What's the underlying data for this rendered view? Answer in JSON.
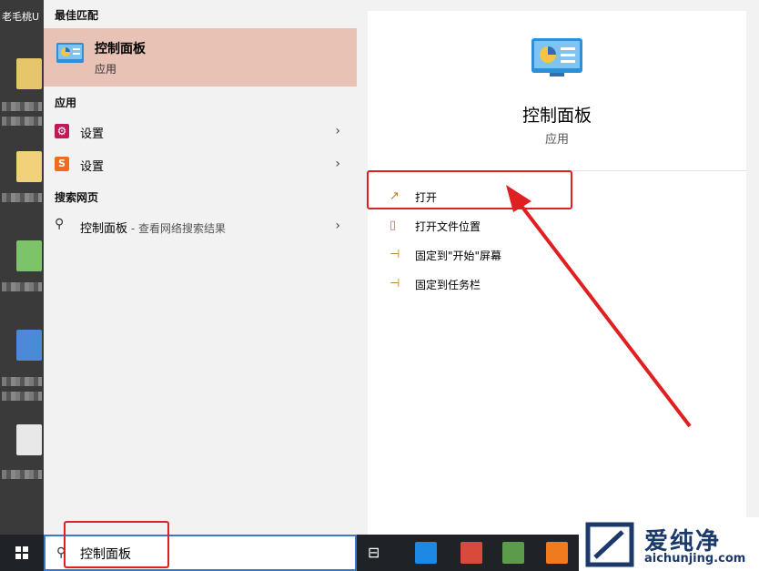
{
  "desktop": {
    "label": "老毛桃U"
  },
  "left": {
    "best_match_label": "最佳匹配",
    "best_match": {
      "title": "控制面板",
      "subtitle": "应用"
    },
    "apps_label": "应用",
    "apps": [
      {
        "label": "设置",
        "icon": "gear-icon",
        "color": "#c2185b"
      },
      {
        "label": "设置",
        "icon": "sogou-s-icon",
        "color": "#f06b1e"
      }
    ],
    "web_label": "搜索网页",
    "web_item": {
      "label": "控制面板",
      "suffix": " - 查看网络搜索结果"
    }
  },
  "right": {
    "title": "控制面板",
    "subtitle": "应用",
    "actions": [
      {
        "label": "打开",
        "icon": "open-icon"
      },
      {
        "label": "打开文件位置",
        "icon": "file-location-icon"
      },
      {
        "label": "固定到\"开始\"屏幕",
        "icon": "pin-icon"
      },
      {
        "label": "固定到任务栏",
        "icon": "pin-icon"
      }
    ]
  },
  "taskbar": {
    "search_value": "控制面板"
  },
  "watermark": {
    "text": "爱纯净",
    "url": "aichunjing.com"
  },
  "colors": {
    "accent": "#3b78c9",
    "highlight": "#e8c2b4",
    "annotation": "#e02020"
  }
}
